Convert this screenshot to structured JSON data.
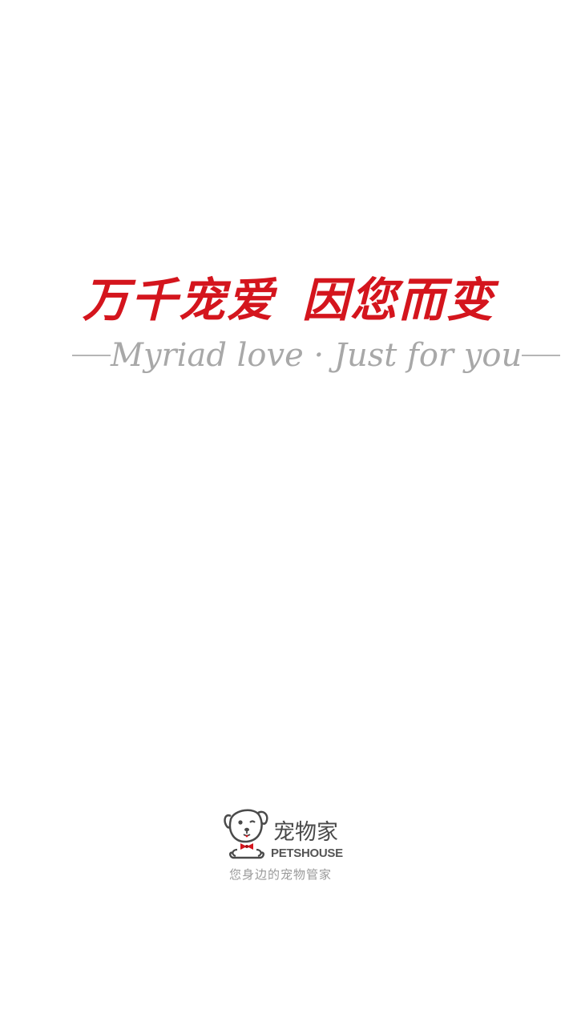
{
  "splash": {
    "slogan_cn_part1": "万千宠爱",
    "slogan_cn_part2": "因您而变",
    "slogan_en": "Myriad love · Just for you"
  },
  "brand": {
    "name_cn": "宠物家",
    "name_en": "PETSHOUSE",
    "tagline": "您身边的宠物管家",
    "mascot_icon": "dog-mascot-icon"
  },
  "colors": {
    "background": "#ffffff",
    "slogan_red": "#d4151d",
    "slogan_gray": "#a8a8a8",
    "logo_dark": "#4a4a4a",
    "bowtie_red": "#d4151d"
  }
}
